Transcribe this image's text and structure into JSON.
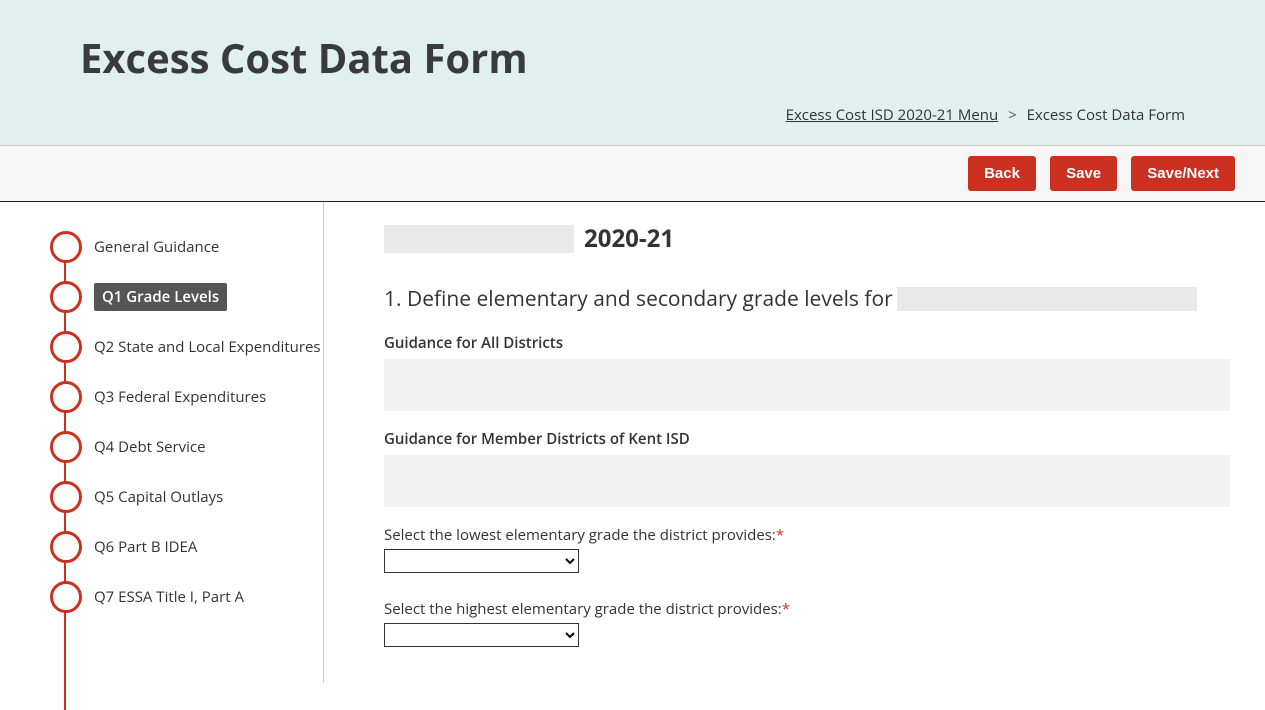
{
  "header": {
    "title": "Excess Cost Data Form"
  },
  "breadcrumb": {
    "parent": "Excess Cost ISD 2020-21 Menu",
    "separator": ">",
    "current": "Excess Cost Data Form"
  },
  "actions": {
    "back": "Back",
    "save": "Save",
    "save_next": "Save/Next"
  },
  "sidebar": {
    "items": [
      {
        "label": "General Guidance",
        "active": false
      },
      {
        "label": "Q1 Grade Levels",
        "active": true
      },
      {
        "label": "Q2 State and Local Expenditures",
        "active": false
      },
      {
        "label": "Q3 Federal Expenditures",
        "active": false
      },
      {
        "label": "Q4 Debt Service",
        "active": false
      },
      {
        "label": "Q5 Capital Outlays",
        "active": false
      },
      {
        "label": "Q6 Part B IDEA",
        "active": false
      },
      {
        "label": "Q7 ESSA Title I, Part A",
        "active": false
      }
    ]
  },
  "content": {
    "year": "2020-21",
    "question_prefix": "1. Define elementary and secondary grade levels for",
    "guidance_all_label": "Guidance for All Districts",
    "guidance_kent_label": "Guidance for Member Districts of Kent ISD",
    "select_lowest_elem": "Select the lowest elementary grade the district provides:",
    "select_highest_elem": "Select the highest elementary grade the district provides:",
    "required_mark": "*"
  }
}
